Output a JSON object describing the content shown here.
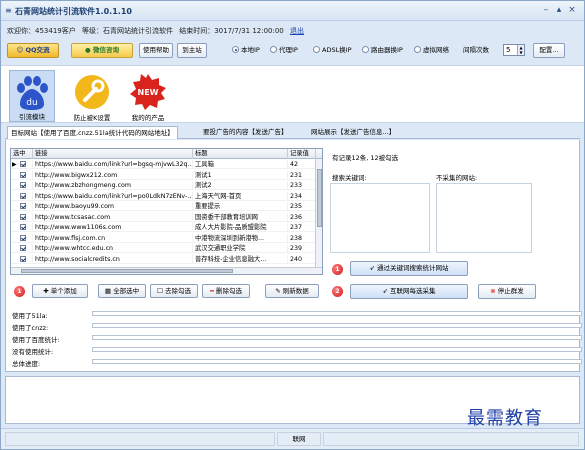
{
  "window": {
    "title": "石青网站统计引流软件1.0.1.10",
    "min": "–",
    "max": "▴",
    "close": "×"
  },
  "info": {
    "welcome": "欢迎你：453419客户",
    "level": "等级：石青网站统计引流软件",
    "expire": "结束时间：3017/7/31 12:00:00",
    "logout": "退出"
  },
  "toolbar": {
    "qq": "QQ交流",
    "wechat": "微信咨询",
    "help": "使用帮助",
    "home": "到主站",
    "radios": [
      {
        "label": "本地IP",
        "on": true
      },
      {
        "label": "代理IP",
        "on": false
      },
      {
        "label": "ADSL换IP",
        "on": false
      },
      {
        "label": "路由器换IP",
        "on": false
      },
      {
        "label": "虚拟网络",
        "on": false
      }
    ],
    "interval_label": "间隔次数",
    "interval_value": "5",
    "config": "配置..."
  },
  "modules": [
    {
      "label": "引流模块"
    },
    {
      "label": "防止被K设置"
    },
    {
      "label": "我的的产品",
      "badge": "NEW"
    }
  ],
  "tabs": [
    "目标网站【使用了百度,cnzz.51la统计代码的网站地址】",
    "要投广告的内容【发送广告】",
    "网站展示【发送广告信息...】"
  ],
  "grid": {
    "headers": [
      "选中",
      "链接",
      "标题",
      "记录值"
    ],
    "rows": [
      {
        "link": "https://www.baidu.com/link?url=bgsq-mjvwL32q...",
        "title": "工具箱",
        "val": "42"
      },
      {
        "link": "http://www.bigwx212.com",
        "title": "测试1",
        "val": "231"
      },
      {
        "link": "http://www.zbzhongmeng.com",
        "title": "测试2",
        "val": "233"
      },
      {
        "link": "https://www.baidu.com/link?url=po0LdkN7zENv-...",
        "title": "上海天气网-首页",
        "val": "234"
      },
      {
        "link": "http://www.baoyu99.com",
        "title": "重要提示",
        "val": "235"
      },
      {
        "link": "http://www.tcsasac.com",
        "title": "国资委干部教育培训网",
        "val": "236"
      },
      {
        "link": "http://www.www1106s.com",
        "title": "成人大片影院-品质盟影院",
        "val": "237"
      },
      {
        "link": "http://www.flsj.com.cn",
        "title": "中港物流深圳到新港物...",
        "val": "238"
      },
      {
        "link": "http://www.whtcc.edu.cn",
        "title": "武汉交通职业学院",
        "val": "239"
      },
      {
        "link": "http://www.socialcredits.cn",
        "title": "普存科技-企业信息融大...",
        "val": "240"
      }
    ]
  },
  "actions": {
    "add": "单个添加",
    "select_all": "全部选中",
    "deselect": "去除勾选",
    "delete": "删除勾选",
    "refresh": "刷新数据"
  },
  "right": {
    "records": "有记录12条, 12被勾选",
    "keyword_label": "搜索关键词:",
    "exclude_label": "不采集的网站:",
    "btn_stats": "通过关键词搜索统计网站",
    "btn_collect": "互联网每选采集",
    "btn_stop": "停止群发",
    "n1": "1",
    "n2": "2"
  },
  "progress": [
    {
      "label": "使用了51la:"
    },
    {
      "label": "使用了cnzz:"
    },
    {
      "label": "使用了百度统计:"
    },
    {
      "label": "没有使用统计:"
    },
    {
      "label": "总体进度:"
    }
  ],
  "status": {
    "center": "联网"
  },
  "watermark": "最需教育"
}
